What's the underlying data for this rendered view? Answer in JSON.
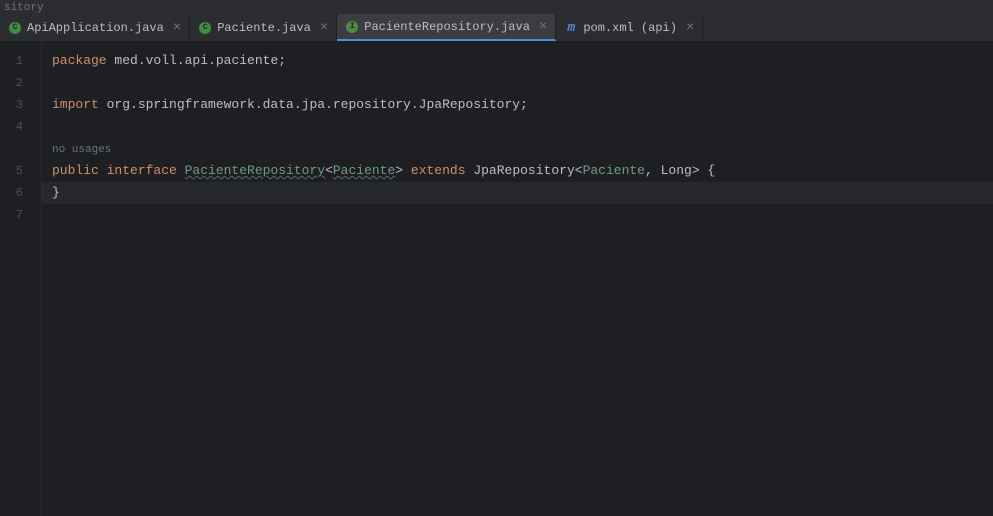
{
  "partialLabel": "sitory",
  "tabs": [
    {
      "label": "ApiApplication.java",
      "icon": "C"
    },
    {
      "label": "Paciente.java",
      "icon": "C"
    },
    {
      "label": "PacienteRepository.java",
      "icon": "I",
      "active": true
    },
    {
      "label": "pom.xml (api)",
      "icon": "m"
    }
  ],
  "gutter": [
    "1",
    "2",
    "3",
    "4",
    "5",
    "6",
    "7"
  ],
  "code": {
    "l1": {
      "kw": "package ",
      "pkg": "med.voll.api.paciente",
      "semi": ";"
    },
    "l3": {
      "kw": "import ",
      "pkg": "org.springframework.data.jpa.repository.JpaRepository",
      "semi": ";"
    },
    "hint": "no usages",
    "l5": {
      "kw1": "public ",
      "kw2": "interface ",
      "name": "PacienteRepository",
      "lt1": "<",
      "tp1": "Paciente",
      "gt1": "> ",
      "kw3": "extends ",
      "jpa": "JpaRepository",
      "lt2": "<",
      "tp2": "Paciente",
      "comma": ", ",
      "long": "Long",
      "gt2": "> {",
      "close": "}"
    }
  }
}
